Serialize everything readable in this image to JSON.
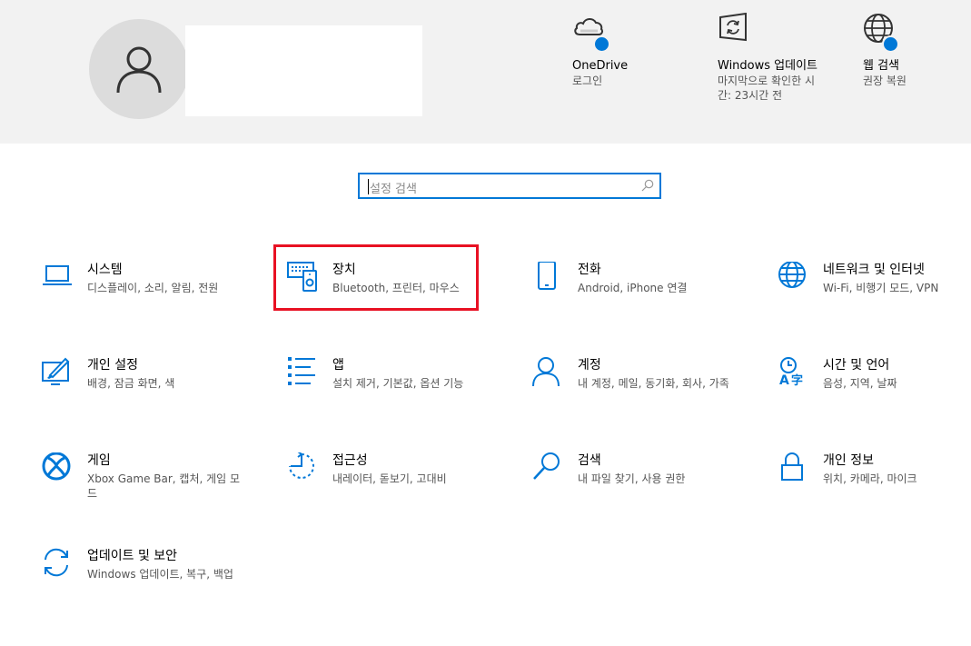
{
  "header": {
    "onedrive": {
      "title": "OneDrive",
      "sub": "로그인"
    },
    "windows_update": {
      "title": "Windows 업데이트",
      "sub": "마지막으로 확인한 시간: 23시간 전"
    },
    "web_search": {
      "title": "웹 검색",
      "sub": "권장 복원"
    }
  },
  "search": {
    "placeholder": "설정 검색"
  },
  "categories": [
    {
      "title": "시스템",
      "sub": "디스플레이, 소리, 알림, 전원",
      "icon": "laptop-icon"
    },
    {
      "title": "장치",
      "sub": "Bluetooth, 프린터, 마우스",
      "icon": "devices-icon"
    },
    {
      "title": "전화",
      "sub": "Android, iPhone 연결",
      "icon": "phone-icon"
    },
    {
      "title": "네트워크 및 인터넷",
      "sub": "Wi-Fi, 비행기 모드, VPN",
      "icon": "globe-icon"
    },
    {
      "title": "개인 설정",
      "sub": "배경, 잠금 화면, 색",
      "icon": "personalization-icon"
    },
    {
      "title": "앱",
      "sub": "설치 제거, 기본값, 옵션 기능",
      "icon": "apps-list-icon"
    },
    {
      "title": "계정",
      "sub": "내 계정, 메일, 동기화, 회사, 가족",
      "icon": "person-icon"
    },
    {
      "title": "시간 및 언어",
      "sub": "음성, 지역, 날짜",
      "icon": "time-language-icon"
    },
    {
      "title": "게임",
      "sub": "Xbox Game Bar, 캡처, 게임 모드",
      "icon": "xbox-icon"
    },
    {
      "title": "접근성",
      "sub": "내레이터, 돋보기, 고대비",
      "icon": "ease-of-access-icon"
    },
    {
      "title": "검색",
      "sub": "내 파일 찾기, 사용 권한",
      "icon": "search-icon"
    },
    {
      "title": "개인 정보",
      "sub": "위치, 카메라, 마이크",
      "icon": "lock-icon"
    },
    {
      "title": "업데이트 및 보안",
      "sub": "Windows 업데이트, 복구, 백업",
      "icon": "update-icon"
    }
  ],
  "colors": {
    "accent": "#0078d7",
    "highlight": "#e81123",
    "header_bg": "#f2f2f2"
  }
}
